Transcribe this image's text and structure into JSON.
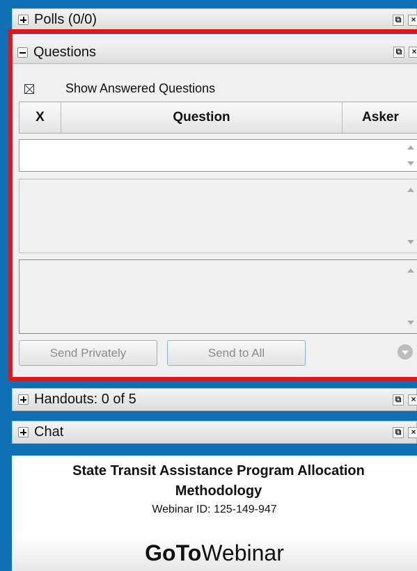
{
  "panels": {
    "polls": {
      "label": "Polls (0/0)"
    },
    "questions": {
      "label": "Questions",
      "show_answered_label": "Show Answered Questions",
      "columns": {
        "x": "X",
        "question": "Question",
        "asker": "Asker"
      },
      "send_privately_label": "Send Privately",
      "send_to_all_label": "Send to All"
    },
    "handouts": {
      "label": "Handouts: 0 of 5"
    },
    "chat": {
      "label": "Chat"
    }
  },
  "webinar": {
    "title": "State Transit Assistance Program Allocation",
    "title_line2": "Methodology",
    "id_line": "Webinar ID: 125-149-947"
  },
  "brand": {
    "bold": "GoTo",
    "regular": "Webinar"
  },
  "icons": {
    "expand": "plus-icon",
    "collapse": "minus-icon",
    "popout": "popout-icon",
    "close": "close-icon"
  },
  "colors": {
    "background": "#0f6fb5",
    "highlight_frame": "#ee1111",
    "button_border": "#8db1e6"
  }
}
